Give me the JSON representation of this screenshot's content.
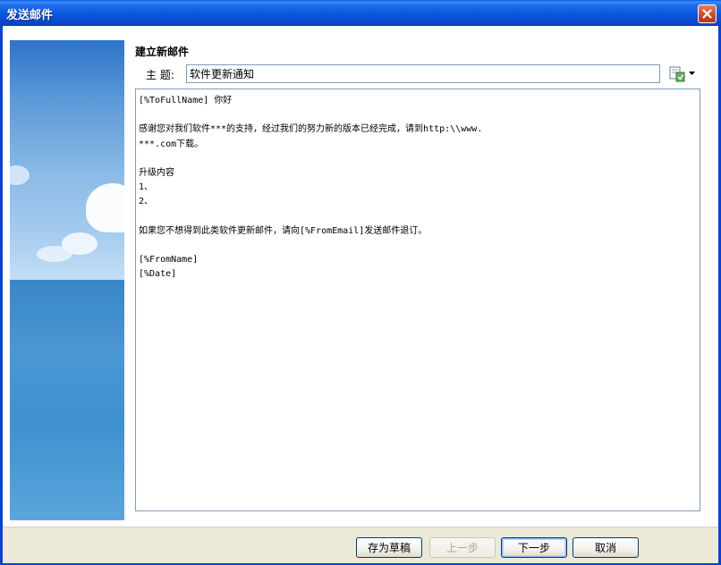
{
  "window": {
    "title": "发送邮件"
  },
  "heading": "建立新邮件",
  "subject": {
    "label": "主 题:",
    "value": "软件更新通知"
  },
  "body_lines": [
    "[%ToFullName] 你好",
    "",
    "感谢您对我们软件***的支持，经过我们的努力新的版本已经完成，请到http:\\\\www.",
    "***.com下载。",
    "",
    "升级内容",
    "1、",
    "2、",
    "",
    "如果您不想得到此类软件更新邮件，请向[%FromEmail]发送邮件退订。",
    "",
    "[%FromName]",
    "[%Date]"
  ],
  "buttons": {
    "save_draft": "存为草稿",
    "prev": "上一步",
    "next": "下一步",
    "cancel": "取消"
  },
  "icons": {
    "close": "close-icon",
    "insert_field": "insert-field-icon",
    "dropdown": "chevron-down-icon"
  },
  "colors": {
    "titlebar": "#0a55e0",
    "border": "#7f9db9",
    "footer": "#ece9d8"
  }
}
